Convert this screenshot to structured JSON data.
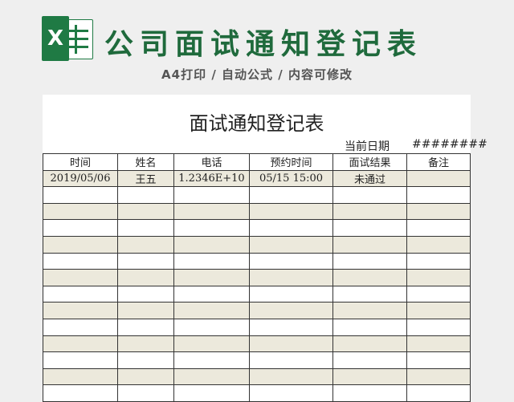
{
  "banner": {
    "logo_letter": "X",
    "title": "公司面试通知登记表",
    "subtitle": "A4打印 / 自动公式 / 内容可修改"
  },
  "document": {
    "title": "面试通知登记表",
    "date_label": "当前日期",
    "date_value": "########",
    "columns": [
      "时间",
      "姓名",
      "电话",
      "预约时间",
      "面试结果",
      "备注"
    ],
    "rows": [
      [
        "2019/05/06",
        "王五",
        "1.2346E+10",
        "05/15 15:00",
        "未通过",
        ""
      ]
    ]
  },
  "colors": {
    "brand_green": "#1f7a44",
    "row_shade": "#ece9dc"
  }
}
